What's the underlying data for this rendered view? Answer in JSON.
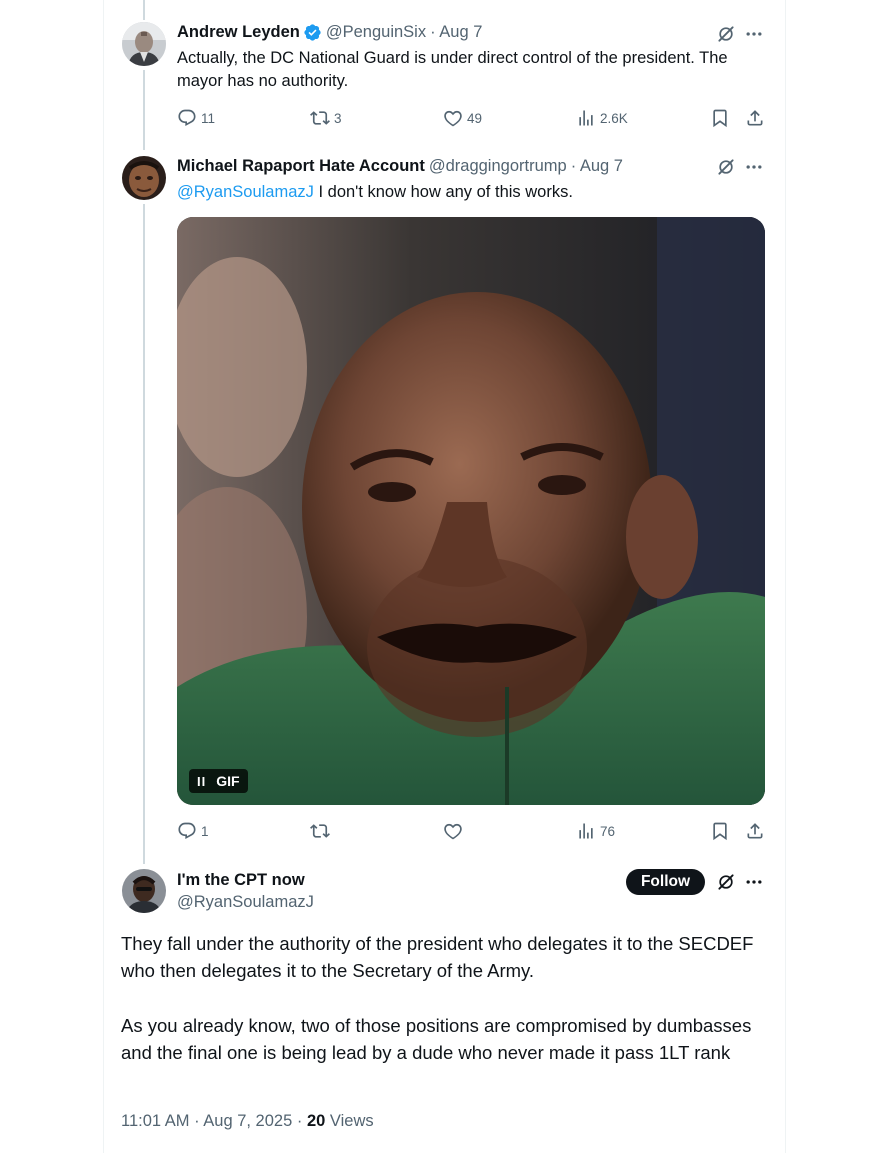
{
  "tweet1": {
    "name": "Andrew Leyden",
    "handle": "@PenguinSix",
    "date": "· Aug 7",
    "text": "Actually, the DC National Guard is under direct control of the president. The mayor has no authority.",
    "replies": "11",
    "retweets": "3",
    "likes": "49",
    "views": "2.6K"
  },
  "tweet2": {
    "name": "Michael Rapaport Hate Account",
    "handle": "@draggingortrump",
    "date": "· Aug 7",
    "mention": "@RyanSoulamazJ",
    "text": " I don't know how any of this works.",
    "media_badge": "GIF",
    "pause_glyph": "II",
    "replies": "1",
    "retweets": "",
    "likes": "",
    "views": "76"
  },
  "main_tweet": {
    "name": "I'm the CPT now",
    "handle": "@RyanSoulamazJ",
    "follow_label": "Follow",
    "paragraph1": "They fall under the authority of the president who delegates it to the SECDEF who then delegates it to the Secretary of the Army.",
    "paragraph2": "As you already know, two of those positions are compromised by dumbasses and the final one is being lead by a dude who never made it pass 1LT rank",
    "time": "11:01 AM",
    "date": "Aug 7, 2025",
    "views_count": "20",
    "views_label": "Views"
  },
  "icons": {
    "more": "more-icon",
    "grok": "grok-icon",
    "reply": "reply-icon",
    "retweet": "retweet-icon",
    "like": "like-icon",
    "views": "views-icon",
    "bookmark": "bookmark-icon",
    "share": "share-icon",
    "verified": "verified-icon"
  },
  "colors": {
    "link": "#1d9bf0",
    "secondary_text": "#536471",
    "primary_text": "#0f1419",
    "verified": "#1d9bf0"
  }
}
